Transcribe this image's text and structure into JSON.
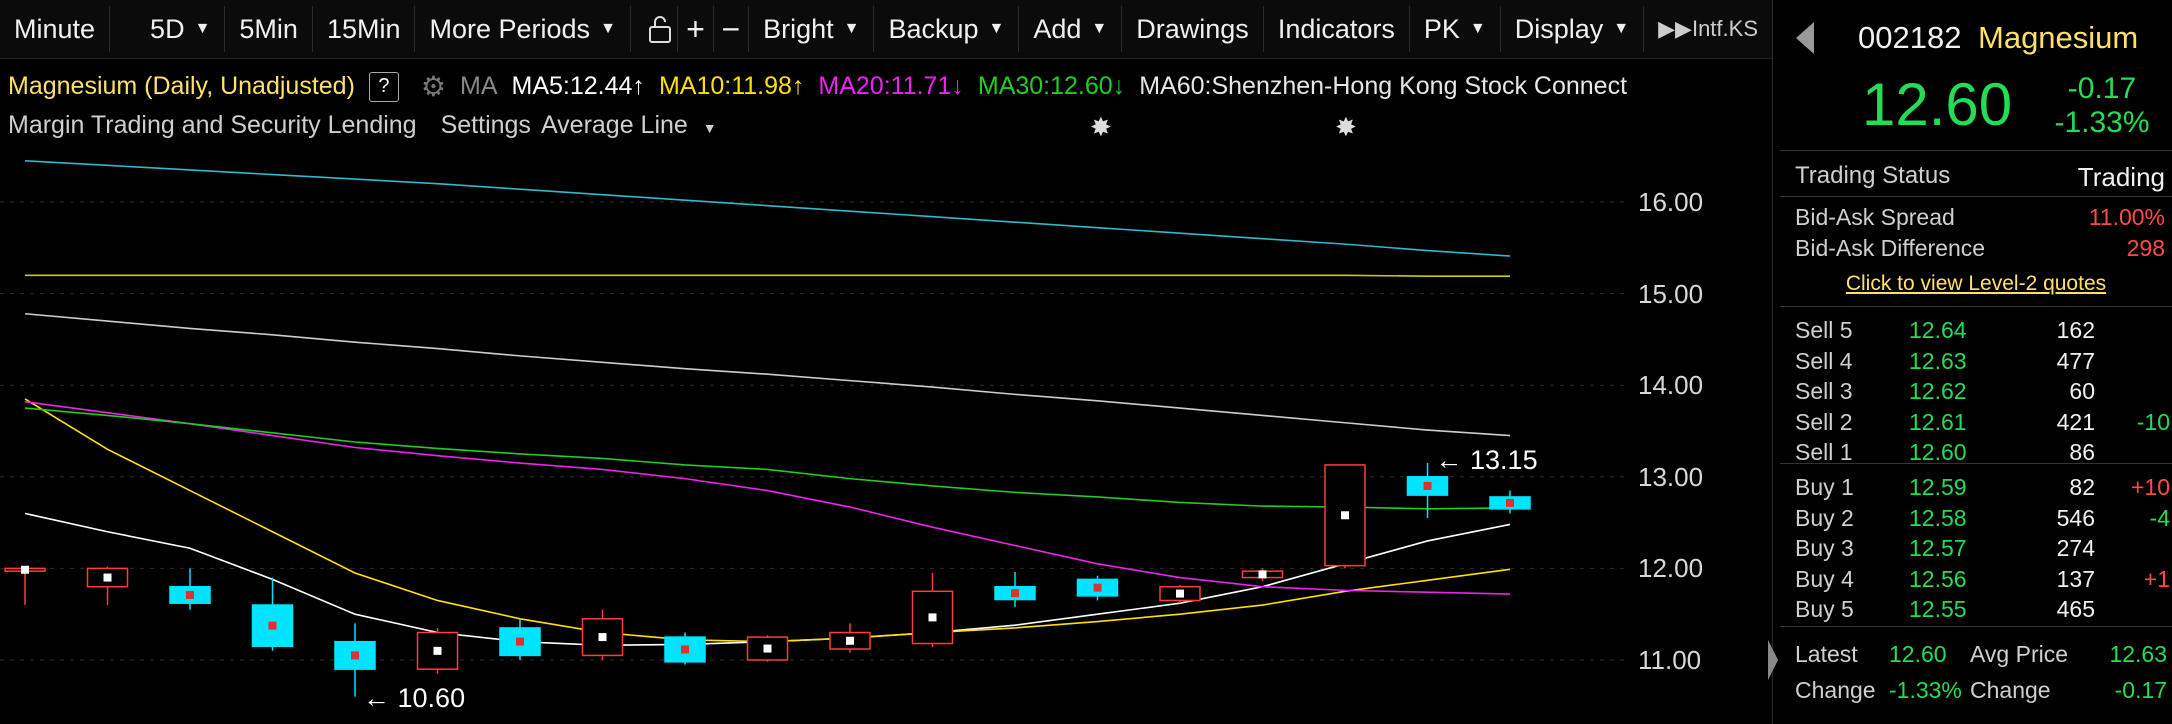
{
  "toolbar": {
    "minute": "Minute",
    "period_5d": "5D",
    "five_min": "5Min",
    "fifteen_min": "15Min",
    "more_periods": "More Periods",
    "bright": "Bright",
    "backup": "Backup",
    "add": "Add",
    "drawings": "Drawings",
    "indicators": "Indicators",
    "pk": "PK",
    "display": "Display",
    "last": "▶▶Intf.KS"
  },
  "chart_header": {
    "title": "Magnesium (Daily, Unadjusted)",
    "help": "?",
    "ma_label": "MA",
    "ma5": "MA5:12.44↑",
    "ma10": "MA10:11.98↑",
    "ma20": "MA20:11.71↓",
    "ma30": "MA30:12.60↓",
    "ma60": "MA60:Shenzhen-Hong Kong Stock Connect",
    "margin": "Margin Trading and Security Lending",
    "settings": "Settings",
    "avg_line": "Average Line"
  },
  "colors": {
    "up": "#ff3b3b",
    "down": "#00e5ff",
    "green": "#22dd55",
    "yellow": "#ffe16a",
    "ma5": "#ffffff",
    "ma10": "#ffe000",
    "ma20": "#ee22ee",
    "ma30": "#22cc22",
    "ma60": "#cccccc",
    "ma_cyan": "#2fb8d0"
  },
  "chart_data": {
    "type": "candlestick",
    "ylim": [
      10.4,
      16.5
    ],
    "yticks": [
      "16.00",
      "15.00",
      "14.00",
      "13.00",
      "12.00",
      "11.00"
    ],
    "candles": [
      {
        "o": 11.97,
        "c": 12.0,
        "h": 12.02,
        "l": 11.6,
        "dir": "up"
      },
      {
        "o": 11.8,
        "c": 12.0,
        "h": 12.02,
        "l": 11.6,
        "dir": "up"
      },
      {
        "o": 11.8,
        "c": 11.62,
        "h": 12.0,
        "l": 11.55,
        "dir": "down"
      },
      {
        "o": 11.6,
        "c": 11.15,
        "h": 11.9,
        "l": 11.1,
        "dir": "down"
      },
      {
        "o": 11.2,
        "c": 10.9,
        "h": 11.4,
        "l": 10.6,
        "dir": "down"
      },
      {
        "o": 10.9,
        "c": 11.3,
        "h": 11.35,
        "l": 10.85,
        "dir": "up"
      },
      {
        "o": 11.35,
        "c": 11.05,
        "h": 11.45,
        "l": 11.0,
        "dir": "down"
      },
      {
        "o": 11.05,
        "c": 11.45,
        "h": 11.55,
        "l": 11.0,
        "dir": "up"
      },
      {
        "o": 11.25,
        "c": 10.98,
        "h": 11.3,
        "l": 10.95,
        "dir": "down"
      },
      {
        "o": 11.0,
        "c": 11.25,
        "h": 11.27,
        "l": 10.98,
        "dir": "up"
      },
      {
        "o": 11.12,
        "c": 11.3,
        "h": 11.4,
        "l": 11.08,
        "dir": "up"
      },
      {
        "o": 11.18,
        "c": 11.75,
        "h": 11.95,
        "l": 11.14,
        "dir": "up"
      },
      {
        "o": 11.8,
        "c": 11.66,
        "h": 11.96,
        "l": 11.58,
        "dir": "down"
      },
      {
        "o": 11.88,
        "c": 11.7,
        "h": 11.92,
        "l": 11.65,
        "dir": "down"
      },
      {
        "o": 11.65,
        "c": 11.8,
        "h": 11.82,
        "l": 11.62,
        "dir": "up"
      },
      {
        "o": 11.9,
        "c": 11.97,
        "h": 12.0,
        "l": 11.86,
        "dir": "up"
      },
      {
        "o": 12.03,
        "c": 13.13,
        "h": 13.13,
        "l": 12.0,
        "dir": "up"
      },
      {
        "o": 13.0,
        "c": 12.8,
        "h": 13.15,
        "l": 12.55,
        "dir": "down"
      },
      {
        "o": 12.78,
        "c": 12.65,
        "h": 12.85,
        "l": 12.6,
        "dir": "down"
      }
    ],
    "moving_averages": [
      {
        "name": "MA5",
        "color": "#ffffff",
        "values": [
          12.6,
          12.4,
          12.22,
          11.88,
          11.5,
          11.3,
          11.2,
          11.16,
          11.17,
          11.2,
          11.24,
          11.3,
          11.38,
          11.5,
          11.62,
          11.8,
          12.05,
          12.3,
          12.48
        ]
      },
      {
        "name": "MA10",
        "color": "#ffe000",
        "values": [
          13.85,
          13.3,
          12.85,
          12.4,
          11.95,
          11.65,
          11.45,
          11.3,
          11.22,
          11.2,
          11.24,
          11.3,
          11.35,
          11.42,
          11.5,
          11.6,
          11.75,
          11.87,
          11.99
        ]
      },
      {
        "name": "MA20",
        "color": "#ee22ee",
        "values": [
          13.82,
          13.7,
          13.58,
          13.45,
          13.32,
          13.23,
          13.15,
          13.08,
          12.98,
          12.85,
          12.67,
          12.45,
          12.25,
          12.05,
          11.9,
          11.8,
          11.76,
          11.74,
          11.72
        ]
      },
      {
        "name": "MA30",
        "color": "#22cc22",
        "values": [
          13.75,
          13.67,
          13.58,
          13.48,
          13.38,
          13.31,
          13.25,
          13.2,
          13.13,
          13.08,
          12.98,
          12.9,
          12.83,
          12.78,
          12.72,
          12.68,
          12.67,
          12.65,
          12.66
        ]
      },
      {
        "name": "MA60",
        "color": "#cccccc",
        "values": [
          14.78,
          14.7,
          14.62,
          14.55,
          14.47,
          14.4,
          14.32,
          14.25,
          14.18,
          14.12,
          14.05,
          13.98,
          13.9,
          13.83,
          13.75,
          13.67,
          13.59,
          13.51,
          13.45
        ]
      },
      {
        "name": "",
        "color": "#2fb8d0",
        "values": [
          16.45,
          16.4,
          16.35,
          16.3,
          16.25,
          16.2,
          16.14,
          16.08,
          16.02,
          15.96,
          15.9,
          15.84,
          15.78,
          15.72,
          15.66,
          15.6,
          15.54,
          15.47,
          15.41
        ]
      },
      {
        "name": "",
        "color": "#cccc00",
        "values": [
          15.2,
          15.2,
          15.2,
          15.2,
          15.2,
          15.2,
          15.2,
          15.2,
          15.2,
          15.2,
          15.2,
          15.2,
          15.2,
          15.2,
          15.2,
          15.2,
          15.2,
          15.19,
          15.19
        ]
      }
    ],
    "annotations": {
      "high": "13.15",
      "low": "10.60"
    }
  },
  "panel": {
    "code": "002182",
    "name": "Magnesium",
    "price": "12.60",
    "change": "-0.17",
    "change_pct": "-1.33%",
    "status_label": "Trading Status",
    "status_value": "Trading",
    "spread_label": "Bid-Ask Spread",
    "spread_value": "11.00%",
    "diff_label": "Bid-Ask Difference",
    "diff_value": "298",
    "level2_link": "Click to view Level-2 quotes",
    "sells": [
      {
        "label": "Sell 5",
        "price": "12.64",
        "vol": "162",
        "delta": ""
      },
      {
        "label": "Sell 4",
        "price": "12.63",
        "vol": "477",
        "delta": ""
      },
      {
        "label": "Sell 3",
        "price": "12.62",
        "vol": "60",
        "delta": ""
      },
      {
        "label": "Sell 2",
        "price": "12.61",
        "vol": "421",
        "delta": "-10"
      },
      {
        "label": "Sell 1",
        "price": "12.60",
        "vol": "86",
        "delta": ""
      }
    ],
    "buys": [
      {
        "label": "Buy 1",
        "price": "12.59",
        "vol": "82",
        "delta": "+10"
      },
      {
        "label": "Buy 2",
        "price": "12.58",
        "vol": "546",
        "delta": "-4"
      },
      {
        "label": "Buy 3",
        "price": "12.57",
        "vol": "274",
        "delta": ""
      },
      {
        "label": "Buy 4",
        "price": "12.56",
        "vol": "137",
        "delta": "+1"
      },
      {
        "label": "Buy 5",
        "price": "12.55",
        "vol": "465",
        "delta": ""
      }
    ],
    "latest_label": "Latest",
    "latest_value": "12.60",
    "avg_label": "Avg Price",
    "avg_value": "12.63",
    "change_label": "Change",
    "change_pct_value": "-1.33%",
    "change_label2": "Change",
    "change_value2": "-0.17"
  }
}
